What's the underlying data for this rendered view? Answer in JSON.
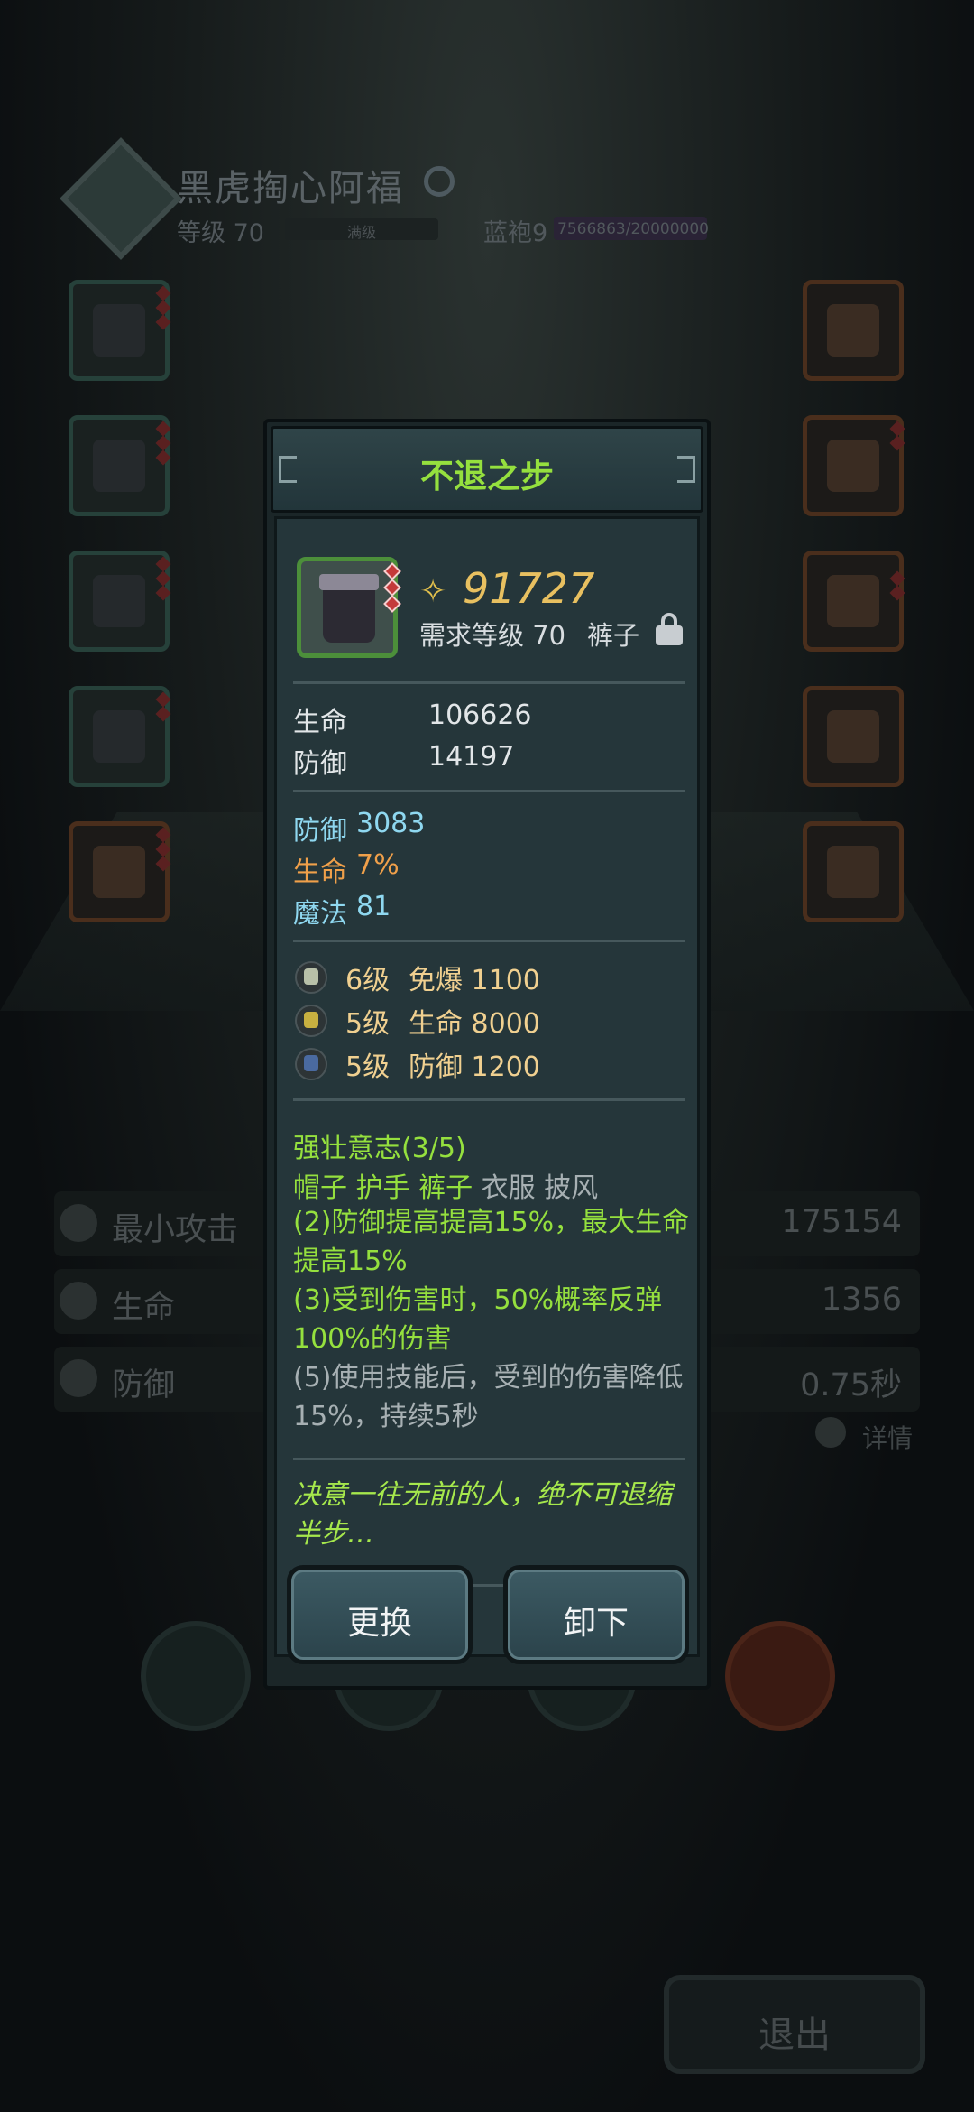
{
  "hero": {
    "name": "黑虎掏心阿福",
    "level": "等级 70",
    "exp_label": "满级",
    "rank": "蓝袍9",
    "rank_progress": "7566863/20000000"
  },
  "stats_bg": [
    {
      "label": "最小攻击",
      "value": "175154"
    },
    {
      "label": "生命",
      "value": "1356"
    },
    {
      "label": "防御",
      "value": "0.75秒"
    }
  ],
  "detail_label": "详情",
  "exit_label": "退出",
  "item": {
    "name": "不退之步",
    "price": "91727",
    "required_level": "需求等级 70",
    "slot_type": "裤子",
    "base_stats": [
      {
        "label": "生命",
        "value": "106626"
      },
      {
        "label": "防御",
        "value": "14197"
      }
    ],
    "bonus_stats": [
      {
        "label": "防御",
        "value": "3083"
      },
      {
        "label": "生命",
        "value": "7%"
      },
      {
        "label": "魔法",
        "value": "81"
      }
    ],
    "gems": [
      {
        "level": "6级",
        "effect": "免爆 1100"
      },
      {
        "level": "5级",
        "effect": "生命 8000"
      },
      {
        "level": "5级",
        "effect": "防御 1200"
      }
    ],
    "set": {
      "title": "强壮意志(3/5)",
      "parts_on": "帽子 护手 裤子",
      "parts_off": "衣服 披风",
      "effect_2": "(2)防御提高提高15%，最大生命提高15%",
      "effect_3": "(3)受到伤害时，50%概率反弹100%的伤害",
      "effect_5": "(5)使用技能后，受到的伤害降低15%，持续5秒"
    },
    "lore": "决意一往无前的人，绝不可退缩半步…"
  },
  "buttons": {
    "replace": "更换",
    "unequip": "卸下"
  }
}
